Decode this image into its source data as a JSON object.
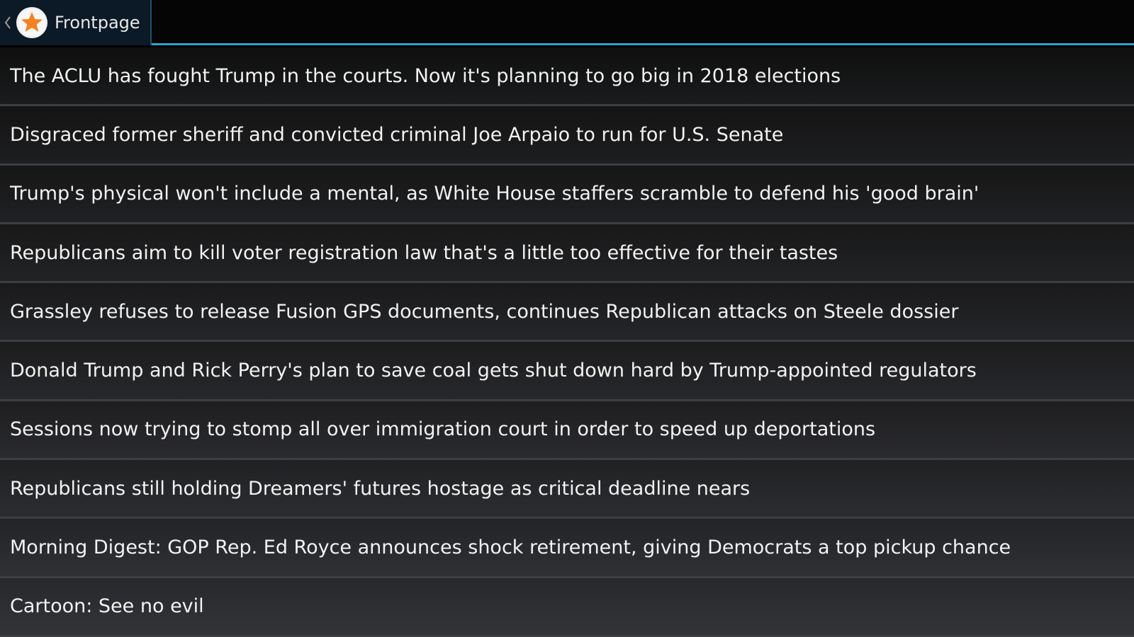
{
  "header": {
    "title": "Frontpage",
    "up_icon": "chevron-left-icon",
    "app_icon": "star-icon",
    "accent_color": "#2aa3d4",
    "icon_color": "#f5821f"
  },
  "articles": [
    "The ACLU has fought Trump in the courts. Now it's planning to go big in 2018 elections",
    "Disgraced former sheriff and convicted criminal Joe Arpaio to run for U.S. Senate",
    "Trump's physical won't include a mental, as White House staffers scramble to defend his 'good brain'",
    "Republicans aim to kill voter registration law that's a little too effective for their tastes",
    "Grassley refuses to release Fusion GPS documents, continues Republican attacks on Steele dossier",
    "Donald Trump and Rick Perry's plan to save coal gets shut down hard by Trump-appointed regulators",
    "Sessions now trying to stomp all over immigration court in order to speed up deportations",
    "Republicans still holding Dreamers' futures hostage as critical deadline nears",
    "Morning Digest: GOP Rep. Ed Royce announces shock retirement, giving Democrats a top pickup chance",
    "Cartoon: See no evil"
  ]
}
